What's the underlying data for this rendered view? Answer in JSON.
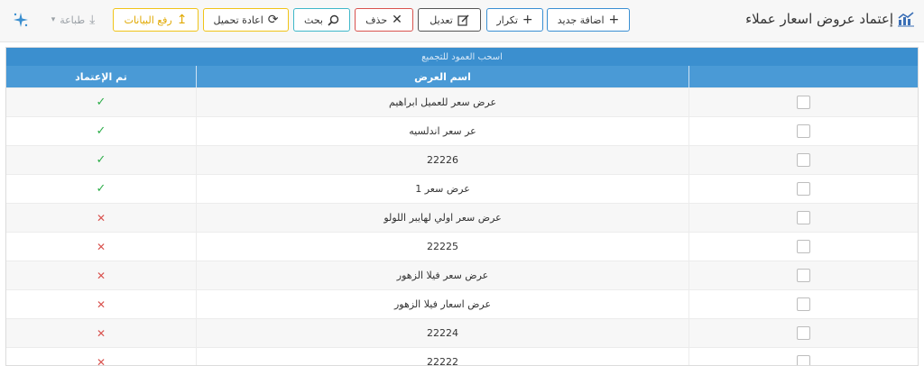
{
  "header": {
    "title": "إعتماد عروض اسعار عملاء",
    "buttons": {
      "add": "اضافة جديد",
      "duplicate": "تكرار",
      "edit": "تعديل",
      "delete": "حذف",
      "search": "بحث",
      "reload": "اعادة تحميل",
      "upload": "رفع البيانات",
      "print": "طباعة"
    }
  },
  "grid": {
    "group_panel_text": "اسحب العمود للتجميع",
    "columns": {
      "approved": "تم الإعتماد",
      "name": "اسم العرض"
    },
    "rows": [
      {
        "name": "عرض سعر للعميل ابراهيم",
        "approved": true
      },
      {
        "name": "عر سعر اندلسيه",
        "approved": true
      },
      {
        "name": "22226",
        "approved": true
      },
      {
        "name": "عرض سعر 1",
        "approved": true
      },
      {
        "name": "عرض سعر اولي لهايبر اللولو",
        "approved": false
      },
      {
        "name": "22225",
        "approved": false
      },
      {
        "name": "عرض سعر فيلا الزهور",
        "approved": false
      },
      {
        "name": "عرض اسعار فيلا الزهور",
        "approved": false
      },
      {
        "name": "22224",
        "approved": false
      },
      {
        "name": "22222",
        "approved": false
      }
    ]
  },
  "colors": {
    "accent": "#3b8fcf",
    "approved": "#2eae4a",
    "rejected": "#d9534f"
  },
  "icons": {
    "title": "chart-icon",
    "approved": "check-icon",
    "rejected": "cross-icon"
  }
}
